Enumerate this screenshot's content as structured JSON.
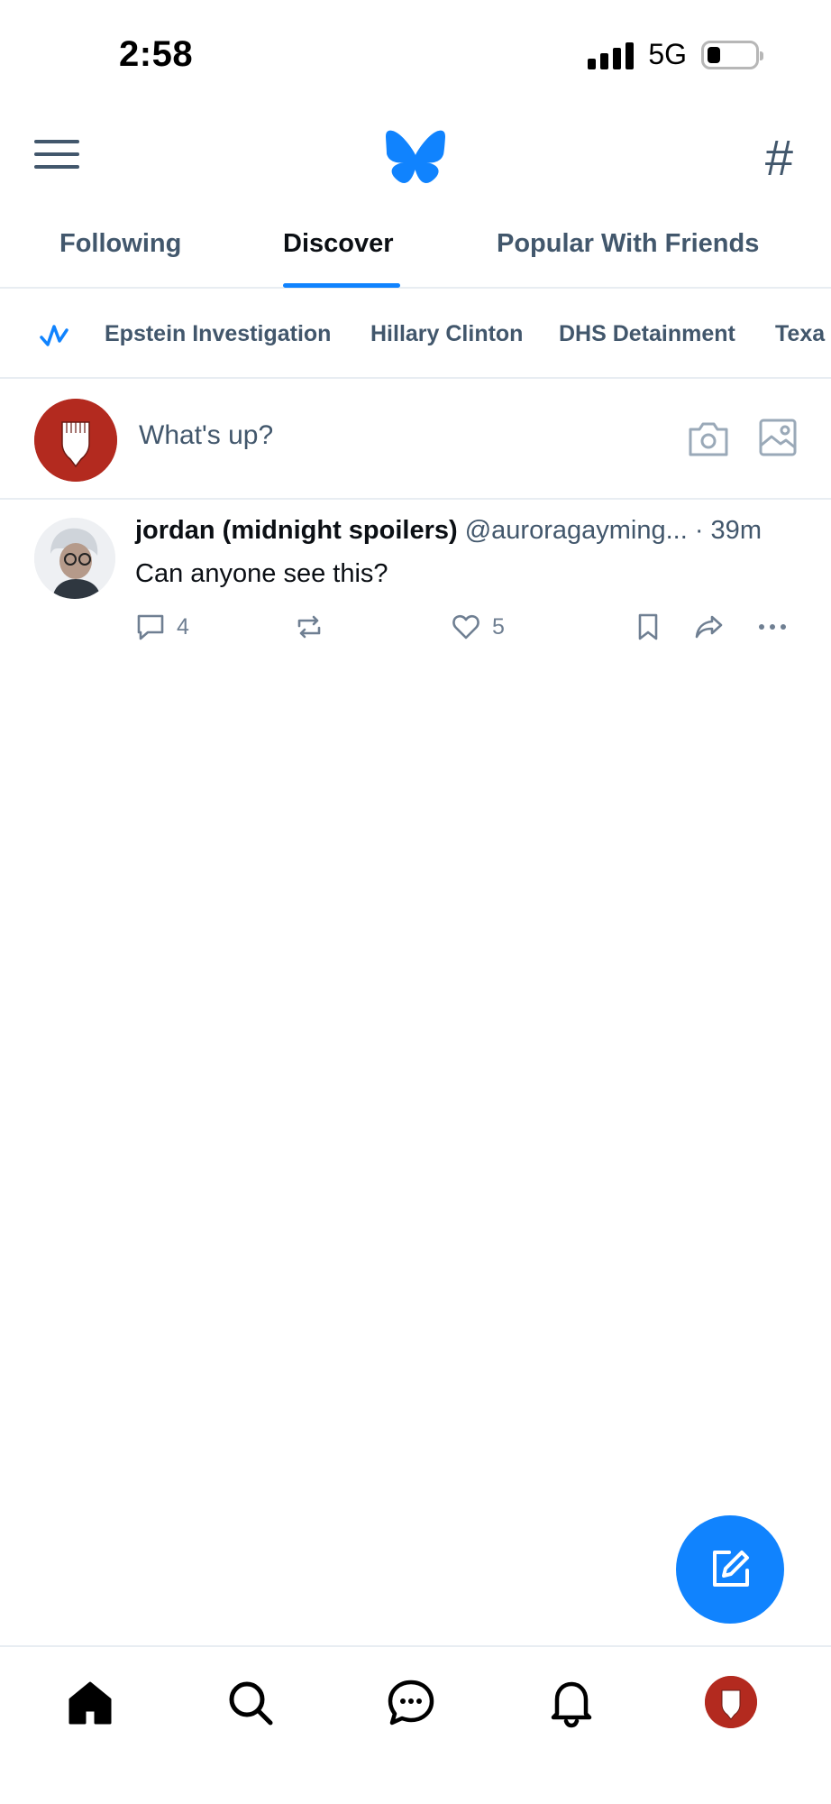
{
  "status_bar": {
    "time": "2:58",
    "network": "5G",
    "signal_icon": "signal-bars-icon",
    "battery_icon": "battery-low-icon"
  },
  "header": {
    "menu_icon": "hamburger-menu-icon",
    "logo_icon": "butterfly-logo-icon",
    "feeds_icon": "hashtag-icon",
    "feeds_glyph": "#"
  },
  "tabs": [
    {
      "label": "Following",
      "active": false
    },
    {
      "label": "Discover",
      "active": true
    },
    {
      "label": "Popular With Friends",
      "active": false
    }
  ],
  "trending": {
    "icon": "trending-pulse-icon",
    "items": [
      "Epstein Investigation",
      "Hillary Clinton",
      "DHS Detainment",
      "Texa"
    ]
  },
  "composer": {
    "placeholder": "What's up?",
    "camera_icon": "camera-icon",
    "image_icon": "image-icon"
  },
  "post": {
    "author": "jordan (midnight spoilers)",
    "handle_time": "@auroragayming... · 39m",
    "text": "Can anyone see this?",
    "reply_count": "4",
    "like_count": "5"
  },
  "fab": {
    "icon": "compose-icon"
  },
  "bottom_nav": {
    "items": [
      "home-icon",
      "search-icon",
      "chat-icon",
      "notifications-bell-icon",
      "profile-avatar"
    ]
  },
  "colors": {
    "accent": "#1083fe",
    "muted": "#42576c",
    "avatar_red": "#b32a1f",
    "divider": "#e8edf2"
  }
}
